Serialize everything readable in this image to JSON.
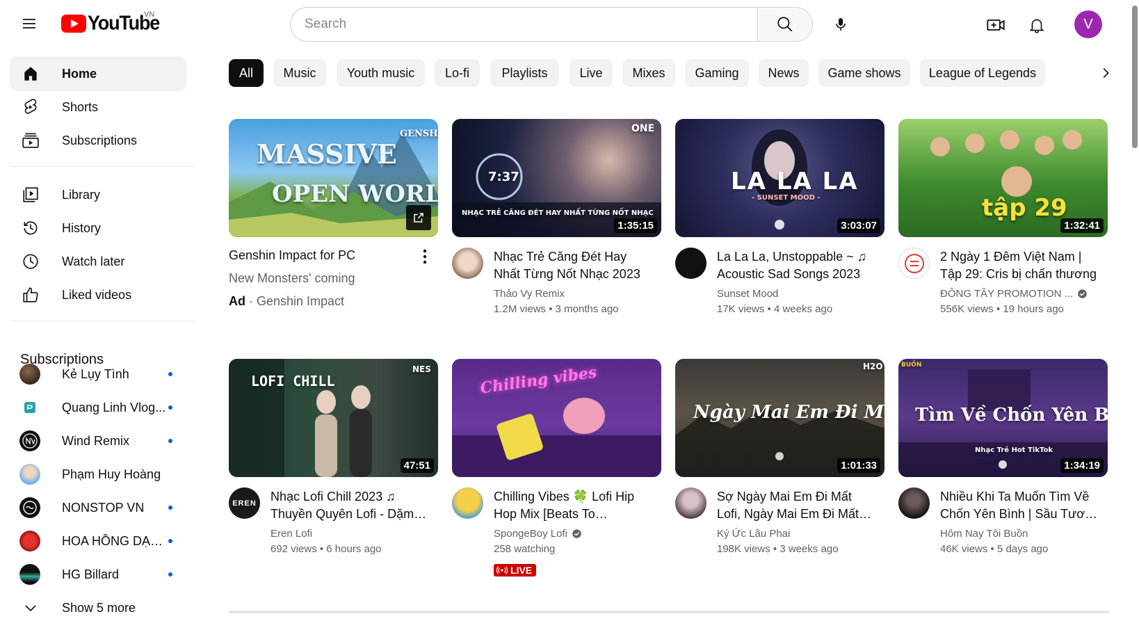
{
  "header": {
    "logo_text": "YouTube",
    "country_code": "VN",
    "search_placeholder": "Search",
    "avatar_letter": "V",
    "avatar_color": "#9c27b0"
  },
  "sidebar": {
    "main": [
      {
        "label": "Home",
        "icon": "home-icon",
        "active": true
      },
      {
        "label": "Shorts",
        "icon": "shorts-icon"
      },
      {
        "label": "Subscriptions",
        "icon": "subscriptions-icon"
      }
    ],
    "library": [
      {
        "label": "Library",
        "icon": "library-icon"
      },
      {
        "label": "History",
        "icon": "history-icon"
      },
      {
        "label": "Watch later",
        "icon": "watch-later-icon"
      },
      {
        "label": "Liked videos",
        "icon": "liked-videos-icon"
      }
    ],
    "subscriptions_heading": "Subscriptions",
    "subscriptions": [
      {
        "name": "Kẻ Lụy Tình",
        "new": true
      },
      {
        "name": "Quang Linh Vlog...",
        "new": true
      },
      {
        "name": "Wind Remix",
        "new": true
      },
      {
        "name": "Phạm Huy Hoàng",
        "new": false
      },
      {
        "name": "NONSTOP VN",
        "new": true
      },
      {
        "name": "HOA HỒNG DẠI ...",
        "new": true
      },
      {
        "name": "HG Billard",
        "new": true
      }
    ],
    "show_more": "Show 5 more"
  },
  "chips": [
    "All",
    "Music",
    "Youth music",
    "Lo-fi",
    "Playlists",
    "Live",
    "Mixes",
    "Gaming",
    "News",
    "Game shows",
    "League of Legends"
  ],
  "ad": {
    "title": "Genshin Impact for PC",
    "subtitle": "New Monsters' coming",
    "ad_label": "Ad",
    "advertiser": "Genshin Impact",
    "thumb_text_1": "MASSIVE",
    "thumb_text_2": "OPEN WORLD",
    "thumb_brand": "GENSHIN"
  },
  "videos": [
    {
      "title": "Nhạc Trẻ Căng Đét Hay Nhất Từng Nốt Nhạc 2023",
      "channel": "Thảo Vy Remix",
      "views": "1.2M views",
      "age": "3 months ago",
      "duration": "1:35:15",
      "thumb_caption": "NHẠC TRẺ CĂNG ĐÉT HAY NHẤT TỪNG NỐT NHẠC",
      "thumb_brand": "ONE",
      "thumb_timer": "7:37",
      "verified": false
    },
    {
      "title": "La La La, Unstoppable ~ ♫ Acoustic Sad Songs 2023",
      "channel": "Sunset Mood",
      "views": "17K views",
      "age": "4 weeks ago",
      "duration": "3:03:07",
      "thumb_caption": "LA LA LA",
      "thumb_subcaption": "- SUNSET MOOD -",
      "verified": false
    },
    {
      "title": "2 Ngày 1 Đêm Việt Nam | Tập 29: Cris bị chấn thương",
      "channel": "ĐÔNG TÂY PROMOTION ...",
      "views": "556K views",
      "age": "19 hours ago",
      "duration": "1:32:41",
      "thumb_caption": "tập 29",
      "verified": true
    },
    {
      "title": "Nhạc Lofi Chill 2023 ♫ Thuyền Quyên Lofi - Dặm Ngàn Thiên Lý",
      "channel": "Eren Lofi",
      "views": "692 views",
      "age": "6 hours ago",
      "duration": "47:51",
      "thumb_caption": "LOFI CHILL",
      "thumb_brand": "NES",
      "verified": false
    },
    {
      "title": "Chilling Vibes 🍀 Lofi Hip Hop Mix [Beats To Relax/Chill To]",
      "channel": "SpongeBoy Lofi",
      "views": "258 watching",
      "age": "",
      "duration": "",
      "live_label": "LIVE",
      "thumb_caption": "Chilling vibes",
      "verified": true
    },
    {
      "title": "Sợ Ngày Mai Em Đi Mất Lofi, Ngày Mai Em Đi Mất Lofi",
      "channel": "Ký Ức Lâu Phai",
      "views": "198K views",
      "age": "3 weeks ago",
      "duration": "1:01:33",
      "thumb_caption": "Ngày Mai Em Đi Mất",
      "thumb_brand": "H2O",
      "verified": false
    },
    {
      "title": "Nhiều Khi Ta Muốn Tìm Về Chốn Yên Bình | Sầu Tương Tư",
      "channel": "Hôm Nay Tôi Buồn",
      "views": "46K views",
      "age": "5 days ago",
      "duration": "1:34:19",
      "thumb_caption": "Tìm Về Chốn Yên Bình",
      "thumb_subcaption": "Nhạc Trẻ Hot TikTok",
      "thumb_brand": "BUỒN",
      "verified": false
    }
  ],
  "colors": {
    "brand_red": "#ff0000",
    "chip_bg": "#f2f2f2",
    "chip_selected_bg": "#0f0f0f",
    "secondary_text": "#606060",
    "new_dot": "#065fd4",
    "live_red": "#cc0000"
  }
}
